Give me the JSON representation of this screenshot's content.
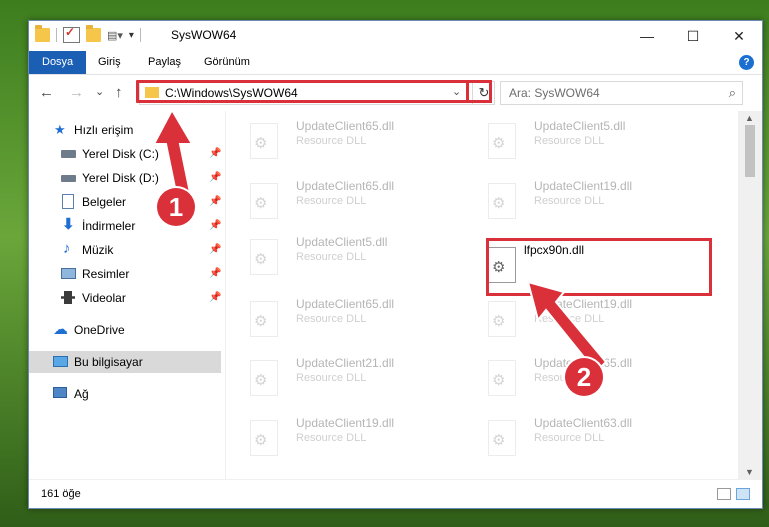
{
  "window": {
    "title": "SysWOW64",
    "controls": {
      "minimize": "—",
      "maximize": "☐",
      "close": "✕"
    }
  },
  "ribbon": {
    "tabs": [
      {
        "label": "Dosya",
        "active": true
      },
      {
        "label": "Giriş"
      },
      {
        "label": "Paylaş"
      },
      {
        "label": "Görünüm"
      }
    ],
    "help": "?"
  },
  "nav": {
    "back": "←",
    "forward": "→",
    "recent": "⌄",
    "up": "↑",
    "address": "C:\\Windows\\SysWOW64",
    "search_placeholder": "Ara: SysWOW64"
  },
  "sidebar": {
    "items": [
      {
        "label": "Hızlı erişim",
        "icon": "star-icon"
      },
      {
        "label": "Yerel Disk (C:)",
        "icon": "drive-icon",
        "pinned": true
      },
      {
        "label": "Yerel Disk (D:)",
        "icon": "drive-icon",
        "pinned": true
      },
      {
        "label": "Belgeler",
        "icon": "documents-icon",
        "pinned": true
      },
      {
        "label": "İndirmeler",
        "icon": "download-icon",
        "pinned": true
      },
      {
        "label": "Müzik",
        "icon": "music-icon",
        "pinned": true
      },
      {
        "label": "Resimler",
        "icon": "pictures-icon",
        "pinned": true
      },
      {
        "label": "Videolar",
        "icon": "videos-icon",
        "pinned": true
      },
      {
        "label": "OneDrive",
        "icon": "cloud-icon"
      },
      {
        "label": "Bu bilgisayar",
        "icon": "computer-icon",
        "selected": true
      },
      {
        "label": "Ağ",
        "icon": "network-icon"
      }
    ]
  },
  "files": [
    {
      "name": "UpdateClient65.dll",
      "desc": "Resource DLL"
    },
    {
      "name": "UpdateClient5.dll",
      "desc": "Resource DLL"
    },
    {
      "name": "UpdateClient65.dll",
      "desc": "Resource DLL"
    },
    {
      "name": "UpdateClient19.dll",
      "desc": "Resource DLL"
    },
    {
      "name": "UpdateClient5.dll",
      "desc": "Resource DLL"
    },
    {
      "name": "lfpcx90n.dll",
      "desc": "",
      "focus": true
    },
    {
      "name": "UpdateClient65.dll",
      "desc": "Resource DLL"
    },
    {
      "name": "UpdateClient19.dll",
      "desc": "Resource DLL"
    },
    {
      "name": "UpdateClient21.dll",
      "desc": "Resource DLL"
    },
    {
      "name": "UpdateClient65.dll",
      "desc": "Resource DLL"
    },
    {
      "name": "UpdateClient19.dll",
      "desc": "Resource DLL"
    },
    {
      "name": "UpdateClient63.dll",
      "desc": "Resource DLL"
    }
  ],
  "status": {
    "count": "161 öğe"
  },
  "annotations": {
    "step1": "1",
    "step2": "2"
  },
  "colors": {
    "accent": "#1a5fb4",
    "highlight": "#d9303a"
  }
}
